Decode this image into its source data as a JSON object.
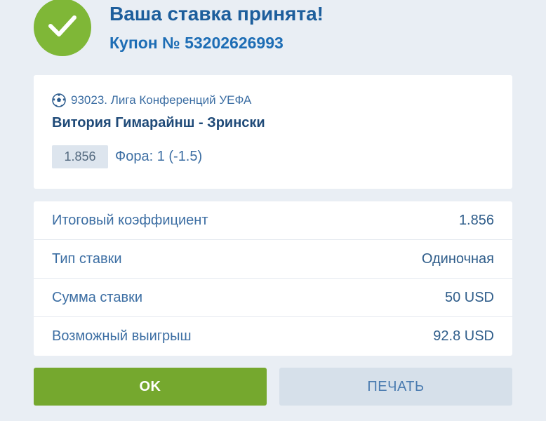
{
  "header": {
    "title": "Ваша ставка принята!",
    "coupon": "Купон № 53202626993",
    "icon": "check-icon"
  },
  "event": {
    "league": "93023. Лига Конференций УЕФА",
    "league_icon": "soccer-ball-icon",
    "match": "Витория Гимарайнш - Зрински",
    "odds": "1.856",
    "bet_type": "Фора: 1 (-1.5)"
  },
  "summary": [
    {
      "label": "Итоговый коэффициент",
      "value": "1.856"
    },
    {
      "label": "Тип ставки",
      "value": "Одиночная"
    },
    {
      "label": "Сумма ставки",
      "value": "50 USD"
    },
    {
      "label": "Возможный выигрыш",
      "value": "92.8 USD"
    }
  ],
  "buttons": {
    "ok": "OK",
    "print": "ПЕЧАТЬ"
  },
  "colors": {
    "accent_green": "#75a82e",
    "brand_blue": "#1d5e9c",
    "background": "#e9eef4"
  }
}
